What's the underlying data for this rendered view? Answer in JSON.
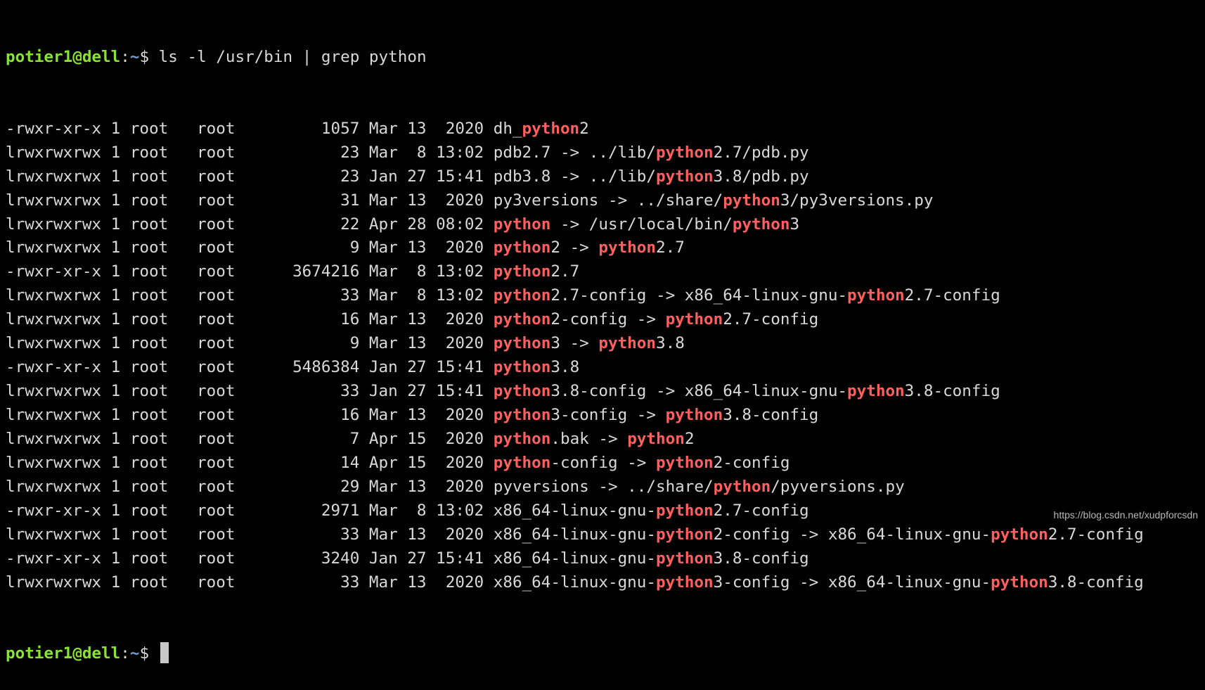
{
  "prompt": {
    "user_host": "potier1@dell",
    "colon": ":",
    "path": "~",
    "symbol": "$ "
  },
  "command": "ls -l /usr/bin | grep python",
  "highlight_term": "python",
  "colors": {
    "background": "#000000",
    "text": "#d9d9d9",
    "prompt_user": "#8ae234",
    "prompt_path": "#729fcf",
    "match_highlight": "#ff5f5f"
  },
  "listing": [
    {
      "perms": "-rwxr-xr-x",
      "links": "1",
      "owner": "root",
      "group": "root",
      "size": "1057",
      "month": "Mar",
      "day": "13",
      "time": "2020",
      "name": "dh_python2"
    },
    {
      "perms": "lrwxrwxrwx",
      "links": "1",
      "owner": "root",
      "group": "root",
      "size": "23",
      "month": "Mar",
      "day": "8",
      "time": "13:02",
      "name": "pdb2.7 -> ../lib/python2.7/pdb.py"
    },
    {
      "perms": "lrwxrwxrwx",
      "links": "1",
      "owner": "root",
      "group": "root",
      "size": "23",
      "month": "Jan",
      "day": "27",
      "time": "15:41",
      "name": "pdb3.8 -> ../lib/python3.8/pdb.py"
    },
    {
      "perms": "lrwxrwxrwx",
      "links": "1",
      "owner": "root",
      "group": "root",
      "size": "31",
      "month": "Mar",
      "day": "13",
      "time": "2020",
      "name": "py3versions -> ../share/python3/py3versions.py"
    },
    {
      "perms": "lrwxrwxrwx",
      "links": "1",
      "owner": "root",
      "group": "root",
      "size": "22",
      "month": "Apr",
      "day": "28",
      "time": "08:02",
      "name": "python -> /usr/local/bin/python3"
    },
    {
      "perms": "lrwxrwxrwx",
      "links": "1",
      "owner": "root",
      "group": "root",
      "size": "9",
      "month": "Mar",
      "day": "13",
      "time": "2020",
      "name": "python2 -> python2.7"
    },
    {
      "perms": "-rwxr-xr-x",
      "links": "1",
      "owner": "root",
      "group": "root",
      "size": "3674216",
      "month": "Mar",
      "day": "8",
      "time": "13:02",
      "name": "python2.7"
    },
    {
      "perms": "lrwxrwxrwx",
      "links": "1",
      "owner": "root",
      "group": "root",
      "size": "33",
      "month": "Mar",
      "day": "8",
      "time": "13:02",
      "name": "python2.7-config -> x86_64-linux-gnu-python2.7-config"
    },
    {
      "perms": "lrwxrwxrwx",
      "links": "1",
      "owner": "root",
      "group": "root",
      "size": "16",
      "month": "Mar",
      "day": "13",
      "time": "2020",
      "name": "python2-config -> python2.7-config"
    },
    {
      "perms": "lrwxrwxrwx",
      "links": "1",
      "owner": "root",
      "group": "root",
      "size": "9",
      "month": "Mar",
      "day": "13",
      "time": "2020",
      "name": "python3 -> python3.8"
    },
    {
      "perms": "-rwxr-xr-x",
      "links": "1",
      "owner": "root",
      "group": "root",
      "size": "5486384",
      "month": "Jan",
      "day": "27",
      "time": "15:41",
      "name": "python3.8"
    },
    {
      "perms": "lrwxrwxrwx",
      "links": "1",
      "owner": "root",
      "group": "root",
      "size": "33",
      "month": "Jan",
      "day": "27",
      "time": "15:41",
      "name": "python3.8-config -> x86_64-linux-gnu-python3.8-config"
    },
    {
      "perms": "lrwxrwxrwx",
      "links": "1",
      "owner": "root",
      "group": "root",
      "size": "16",
      "month": "Mar",
      "day": "13",
      "time": "2020",
      "name": "python3-config -> python3.8-config"
    },
    {
      "perms": "lrwxrwxrwx",
      "links": "1",
      "owner": "root",
      "group": "root",
      "size": "7",
      "month": "Apr",
      "day": "15",
      "time": "2020",
      "name": "python.bak -> python2"
    },
    {
      "perms": "lrwxrwxrwx",
      "links": "1",
      "owner": "root",
      "group": "root",
      "size": "14",
      "month": "Apr",
      "day": "15",
      "time": "2020",
      "name": "python-config -> python2-config"
    },
    {
      "perms": "lrwxrwxrwx",
      "links": "1",
      "owner": "root",
      "group": "root",
      "size": "29",
      "month": "Mar",
      "day": "13",
      "time": "2020",
      "name": "pyversions -> ../share/python/pyversions.py"
    },
    {
      "perms": "-rwxr-xr-x",
      "links": "1",
      "owner": "root",
      "group": "root",
      "size": "2971",
      "month": "Mar",
      "day": "8",
      "time": "13:02",
      "name": "x86_64-linux-gnu-python2.7-config"
    },
    {
      "perms": "lrwxrwxrwx",
      "links": "1",
      "owner": "root",
      "group": "root",
      "size": "33",
      "month": "Mar",
      "day": "13",
      "time": "2020",
      "name": "x86_64-linux-gnu-python2-config -> x86_64-linux-gnu-python2.7-config"
    },
    {
      "perms": "-rwxr-xr-x",
      "links": "1",
      "owner": "root",
      "group": "root",
      "size": "3240",
      "month": "Jan",
      "day": "27",
      "time": "15:41",
      "name": "x86_64-linux-gnu-python3.8-config"
    },
    {
      "perms": "lrwxrwxrwx",
      "links": "1",
      "owner": "root",
      "group": "root",
      "size": "33",
      "month": "Mar",
      "day": "13",
      "time": "2020",
      "name": "x86_64-linux-gnu-python3-config -> x86_64-linux-gnu-python3.8-config"
    }
  ],
  "watermark": "https://blog.csdn.net/xudpforcsdn"
}
